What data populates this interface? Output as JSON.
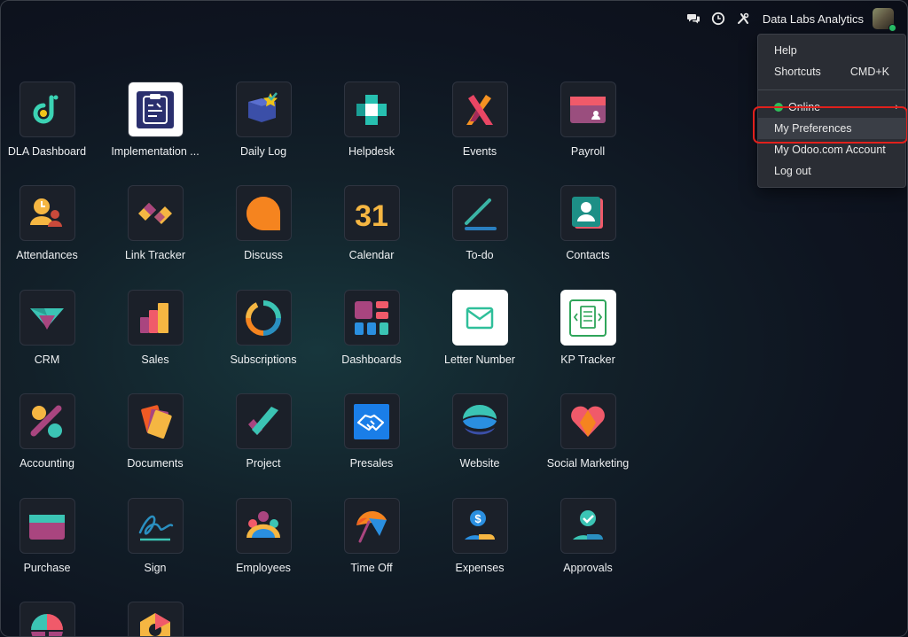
{
  "topbar": {
    "company": "Data Labs Analytics",
    "icons": [
      "chat-icon",
      "clock-icon",
      "tools-icon"
    ]
  },
  "menu": {
    "help": "Help",
    "shortcuts": "Shortcuts",
    "shortcuts_key": "CMD+K",
    "online": "Online",
    "preferences": "My Preferences",
    "account": "My Odoo.com Account",
    "logout": "Log out"
  },
  "apps": [
    {
      "label": "DLA Dashboard"
    },
    {
      "label": "Implementation ..."
    },
    {
      "label": "Daily Log"
    },
    {
      "label": "Helpdesk"
    },
    {
      "label": "Events"
    },
    {
      "label": "Payroll"
    },
    {
      "label": "Attendances"
    },
    {
      "label": "Link Tracker"
    },
    {
      "label": "Discuss"
    },
    {
      "label": "Calendar"
    },
    {
      "label": "To-do"
    },
    {
      "label": "Contacts"
    },
    {
      "label": "CRM"
    },
    {
      "label": "Sales"
    },
    {
      "label": "Subscriptions"
    },
    {
      "label": "Dashboards"
    },
    {
      "label": "Letter Number"
    },
    {
      "label": "KP Tracker"
    },
    {
      "label": "Accounting"
    },
    {
      "label": "Documents"
    },
    {
      "label": "Project"
    },
    {
      "label": "Presales"
    },
    {
      "label": "Website"
    },
    {
      "label": "Social Marketing"
    },
    {
      "label": "Purchase"
    },
    {
      "label": "Sign"
    },
    {
      "label": "Employees"
    },
    {
      "label": "Time Off"
    },
    {
      "label": "Expenses"
    },
    {
      "label": "Approvals"
    },
    {
      "label": ""
    },
    {
      "label": ""
    }
  ],
  "calendar_day": "31"
}
